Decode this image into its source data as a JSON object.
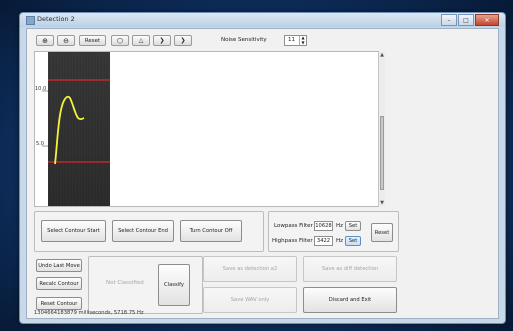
{
  "window": {
    "title": "Detection 2"
  },
  "toolbar": {
    "reset_label": "Reset",
    "noise_label": "Noise Sensitivity",
    "noise_value": "11"
  },
  "plot": {
    "y_tick_10": "10.0",
    "y_tick_5": "5.0"
  },
  "contour": {
    "select_start": "Select Contour Start",
    "select_end": "Select Contour End",
    "turn_off": "Turn Contour Off"
  },
  "filters": {
    "lowpass_label": "Lowpass Filter",
    "lowpass_value": "10628",
    "highpass_label": "Highpass Filter",
    "highpass_value": "3422",
    "unit": "Hz",
    "set_label": "Set",
    "reset_label": "Reset"
  },
  "actions": {
    "undo_last_move": "Undo Last Move",
    "recalc_contour": "Recalc Contour",
    "reset_contour": "Reset Contour",
    "not_classified": "Not Classified",
    "classify": "Classify",
    "save_as_detection": "Save as detection a2",
    "save_as_diff": "Save as diff detection",
    "save_wav_only": "Save WAV only",
    "discard_exit": "Discard and Exit"
  },
  "status": {
    "text": "1304664183879 milliseconds, 5718.75 Hz"
  },
  "colors": {
    "contour": "#f4f43a",
    "threshold_line": "#d8262b"
  }
}
